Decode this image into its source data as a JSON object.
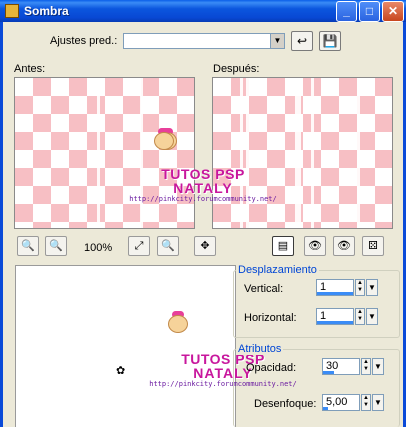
{
  "window": {
    "title": "Sombra"
  },
  "presets": {
    "label": "Ajustes pred.:",
    "value": ""
  },
  "previews": {
    "before_label": "Antes:",
    "after_label": "Después:"
  },
  "watermark": {
    "line1": "TUTOS PSP",
    "line2": "NATALY",
    "url": "http://pinkcity.forumcommunity.net/"
  },
  "toolbar": {
    "zoom": "100%"
  },
  "displacement": {
    "title": "Desplazamiento",
    "vertical_label": "Vertical:",
    "vertical_value": "1",
    "horizontal_label": "Horizontal:",
    "horizontal_value": "1"
  },
  "attributes": {
    "title": "Atributos",
    "opacity_label": "Opacidad:",
    "opacity_value": "30",
    "blur_label": "Desenfoque:",
    "blur_value": "5,00"
  },
  "colors": {
    "accent": "#0046d5",
    "titlebar": "#0a5ee8",
    "checker_pink": "#f7bfc4",
    "watermark_pink": "#c8179d"
  }
}
